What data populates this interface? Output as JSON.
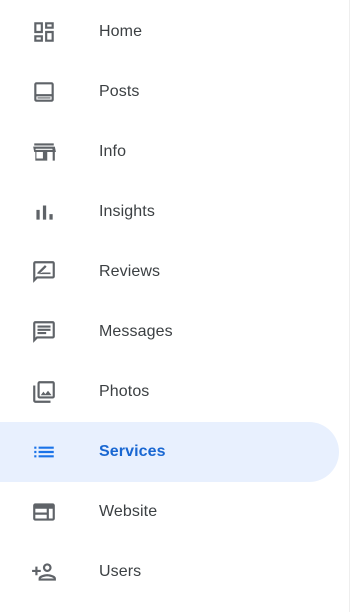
{
  "nav": {
    "items": [
      {
        "label": "Home",
        "icon": "dashboard-icon",
        "active": false
      },
      {
        "label": "Posts",
        "icon": "posts-icon",
        "active": false
      },
      {
        "label": "Info",
        "icon": "storefront-icon",
        "active": false
      },
      {
        "label": "Insights",
        "icon": "bar-chart-icon",
        "active": false
      },
      {
        "label": "Reviews",
        "icon": "rate-review-icon",
        "active": false
      },
      {
        "label": "Messages",
        "icon": "chat-icon",
        "active": false
      },
      {
        "label": "Photos",
        "icon": "photo-library-icon",
        "active": false
      },
      {
        "label": "Services",
        "icon": "list-icon",
        "active": true
      },
      {
        "label": "Website",
        "icon": "web-icon",
        "active": false
      },
      {
        "label": "Users",
        "icon": "person-add-icon",
        "active": false
      }
    ]
  },
  "colors": {
    "icon_default": "#5f6368",
    "text_default": "#3c4043",
    "active_background": "#e8f0fe",
    "active_text": "#1967d2",
    "active_icon": "#1a73e8"
  }
}
